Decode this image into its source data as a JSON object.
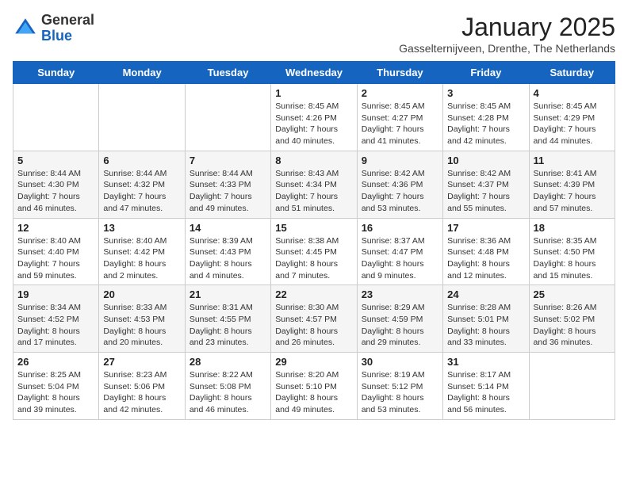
{
  "header": {
    "logo_general": "General",
    "logo_blue": "Blue",
    "title": "January 2025",
    "subtitle": "Gasselternijveen, Drenthe, The Netherlands"
  },
  "days_of_week": [
    "Sunday",
    "Monday",
    "Tuesday",
    "Wednesday",
    "Thursday",
    "Friday",
    "Saturday"
  ],
  "weeks": [
    [
      {
        "day": "",
        "info": ""
      },
      {
        "day": "",
        "info": ""
      },
      {
        "day": "",
        "info": ""
      },
      {
        "day": "1",
        "info": "Sunrise: 8:45 AM\nSunset: 4:26 PM\nDaylight: 7 hours\nand 40 minutes."
      },
      {
        "day": "2",
        "info": "Sunrise: 8:45 AM\nSunset: 4:27 PM\nDaylight: 7 hours\nand 41 minutes."
      },
      {
        "day": "3",
        "info": "Sunrise: 8:45 AM\nSunset: 4:28 PM\nDaylight: 7 hours\nand 42 minutes."
      },
      {
        "day": "4",
        "info": "Sunrise: 8:45 AM\nSunset: 4:29 PM\nDaylight: 7 hours\nand 44 minutes."
      }
    ],
    [
      {
        "day": "5",
        "info": "Sunrise: 8:44 AM\nSunset: 4:30 PM\nDaylight: 7 hours\nand 46 minutes."
      },
      {
        "day": "6",
        "info": "Sunrise: 8:44 AM\nSunset: 4:32 PM\nDaylight: 7 hours\nand 47 minutes."
      },
      {
        "day": "7",
        "info": "Sunrise: 8:44 AM\nSunset: 4:33 PM\nDaylight: 7 hours\nand 49 minutes."
      },
      {
        "day": "8",
        "info": "Sunrise: 8:43 AM\nSunset: 4:34 PM\nDaylight: 7 hours\nand 51 minutes."
      },
      {
        "day": "9",
        "info": "Sunrise: 8:42 AM\nSunset: 4:36 PM\nDaylight: 7 hours\nand 53 minutes."
      },
      {
        "day": "10",
        "info": "Sunrise: 8:42 AM\nSunset: 4:37 PM\nDaylight: 7 hours\nand 55 minutes."
      },
      {
        "day": "11",
        "info": "Sunrise: 8:41 AM\nSunset: 4:39 PM\nDaylight: 7 hours\nand 57 minutes."
      }
    ],
    [
      {
        "day": "12",
        "info": "Sunrise: 8:40 AM\nSunset: 4:40 PM\nDaylight: 7 hours\nand 59 minutes."
      },
      {
        "day": "13",
        "info": "Sunrise: 8:40 AM\nSunset: 4:42 PM\nDaylight: 8 hours\nand 2 minutes."
      },
      {
        "day": "14",
        "info": "Sunrise: 8:39 AM\nSunset: 4:43 PM\nDaylight: 8 hours\nand 4 minutes."
      },
      {
        "day": "15",
        "info": "Sunrise: 8:38 AM\nSunset: 4:45 PM\nDaylight: 8 hours\nand 7 minutes."
      },
      {
        "day": "16",
        "info": "Sunrise: 8:37 AM\nSunset: 4:47 PM\nDaylight: 8 hours\nand 9 minutes."
      },
      {
        "day": "17",
        "info": "Sunrise: 8:36 AM\nSunset: 4:48 PM\nDaylight: 8 hours\nand 12 minutes."
      },
      {
        "day": "18",
        "info": "Sunrise: 8:35 AM\nSunset: 4:50 PM\nDaylight: 8 hours\nand 15 minutes."
      }
    ],
    [
      {
        "day": "19",
        "info": "Sunrise: 8:34 AM\nSunset: 4:52 PM\nDaylight: 8 hours\nand 17 minutes."
      },
      {
        "day": "20",
        "info": "Sunrise: 8:33 AM\nSunset: 4:53 PM\nDaylight: 8 hours\nand 20 minutes."
      },
      {
        "day": "21",
        "info": "Sunrise: 8:31 AM\nSunset: 4:55 PM\nDaylight: 8 hours\nand 23 minutes."
      },
      {
        "day": "22",
        "info": "Sunrise: 8:30 AM\nSunset: 4:57 PM\nDaylight: 8 hours\nand 26 minutes."
      },
      {
        "day": "23",
        "info": "Sunrise: 8:29 AM\nSunset: 4:59 PM\nDaylight: 8 hours\nand 29 minutes."
      },
      {
        "day": "24",
        "info": "Sunrise: 8:28 AM\nSunset: 5:01 PM\nDaylight: 8 hours\nand 33 minutes."
      },
      {
        "day": "25",
        "info": "Sunrise: 8:26 AM\nSunset: 5:02 PM\nDaylight: 8 hours\nand 36 minutes."
      }
    ],
    [
      {
        "day": "26",
        "info": "Sunrise: 8:25 AM\nSunset: 5:04 PM\nDaylight: 8 hours\nand 39 minutes."
      },
      {
        "day": "27",
        "info": "Sunrise: 8:23 AM\nSunset: 5:06 PM\nDaylight: 8 hours\nand 42 minutes."
      },
      {
        "day": "28",
        "info": "Sunrise: 8:22 AM\nSunset: 5:08 PM\nDaylight: 8 hours\nand 46 minutes."
      },
      {
        "day": "29",
        "info": "Sunrise: 8:20 AM\nSunset: 5:10 PM\nDaylight: 8 hours\nand 49 minutes."
      },
      {
        "day": "30",
        "info": "Sunrise: 8:19 AM\nSunset: 5:12 PM\nDaylight: 8 hours\nand 53 minutes."
      },
      {
        "day": "31",
        "info": "Sunrise: 8:17 AM\nSunset: 5:14 PM\nDaylight: 8 hours\nand 56 minutes."
      },
      {
        "day": "",
        "info": ""
      }
    ]
  ]
}
